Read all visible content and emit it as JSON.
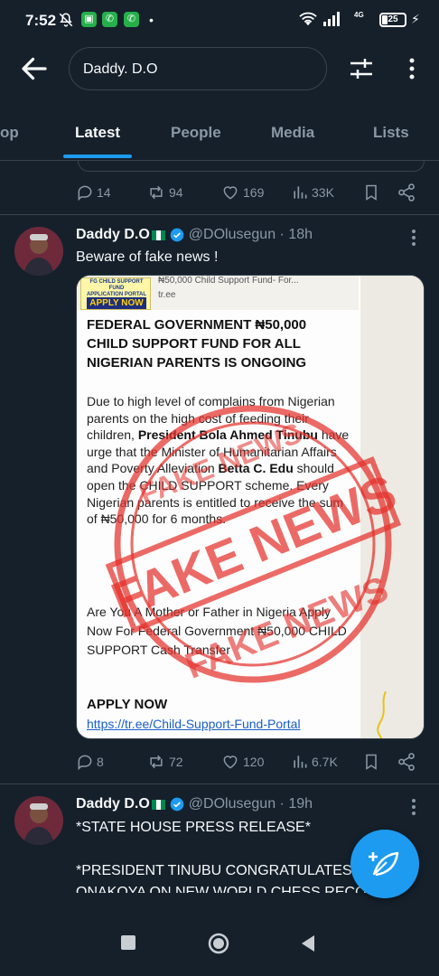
{
  "status_bar": {
    "time": "7:52",
    "network_label": "4G",
    "battery_level": "25",
    "battery_percent": 25
  },
  "header": {
    "search_value": "Daddy. D.O"
  },
  "tabs": [
    {
      "label": "op",
      "active": false
    },
    {
      "label": "Latest",
      "active": true
    },
    {
      "label": "People",
      "active": false
    },
    {
      "label": "Media",
      "active": false
    },
    {
      "label": "Lists",
      "active": false
    }
  ],
  "prev_tweet": {
    "replies": "14",
    "retweets": "94",
    "likes": "169",
    "views": "33K"
  },
  "tweets": [
    {
      "name": "Daddy D.O",
      "handle": "@DOlusegun",
      "time": "18h",
      "text": "Beware of fake news !",
      "media": {
        "link_title": "₦50,000 Child Support Fund- For...",
        "link_domain": "tr.ee",
        "thumb_line1": "FG CHILD SUPPORT FUND",
        "thumb_line2": "APPLICATION PORTAL",
        "thumb_button": "APPLY NOW",
        "headline": "FEDERAL GOVERNMENT ₦50,000 CHILD SUPPORT FUND FOR ALL NIGERIAN PARENTS IS ONGOING",
        "body_1": "Due to high level of complains from Nigerian parents on the high cost of feeding their children, ",
        "body_bold_1": "President Bola Ahmed Tinubu",
        "body_2": " have urge that the Minister of Humanitarian Affairs and Poverty Alleviation ",
        "body_bold_2": "Betta C. Edu",
        "body_3": " should open the CHILD SUPPORT scheme. Every Nigerian parents is entitled to receive the sum of ₦50,000 for 6 months.",
        "question": "Are You A Mother or Father in Nigeria Apply Now For Federal Government ₦50,000 CHILD SUPPORT Cash Transfer",
        "apply": "APPLY NOW",
        "link": "https://tr.ee/Child-Support-Fund-Portal",
        "stamp_text": "FAKE NEWS"
      },
      "replies": "8",
      "retweets": "72",
      "likes": "120",
      "views": "6.7K"
    },
    {
      "name": "Daddy D.O",
      "handle": "@DOlusegun",
      "time": "19h",
      "text": "*STATE HOUSE PRESS RELEASE*\n\n*PRESIDENT TINUBU CONGRATULATES T\nONAKOYA ON NEW WORLD CHESS RECOR"
    }
  ],
  "icons": {
    "back": "arrow-left-icon",
    "filter": "sliders-icon",
    "more": "kebab-icon",
    "compose": "feather-plus-icon"
  },
  "colors": {
    "background": "#15202b",
    "accent": "#1d9bf0",
    "muted": "#8b98a5",
    "stamp_red": "#e4312b"
  }
}
